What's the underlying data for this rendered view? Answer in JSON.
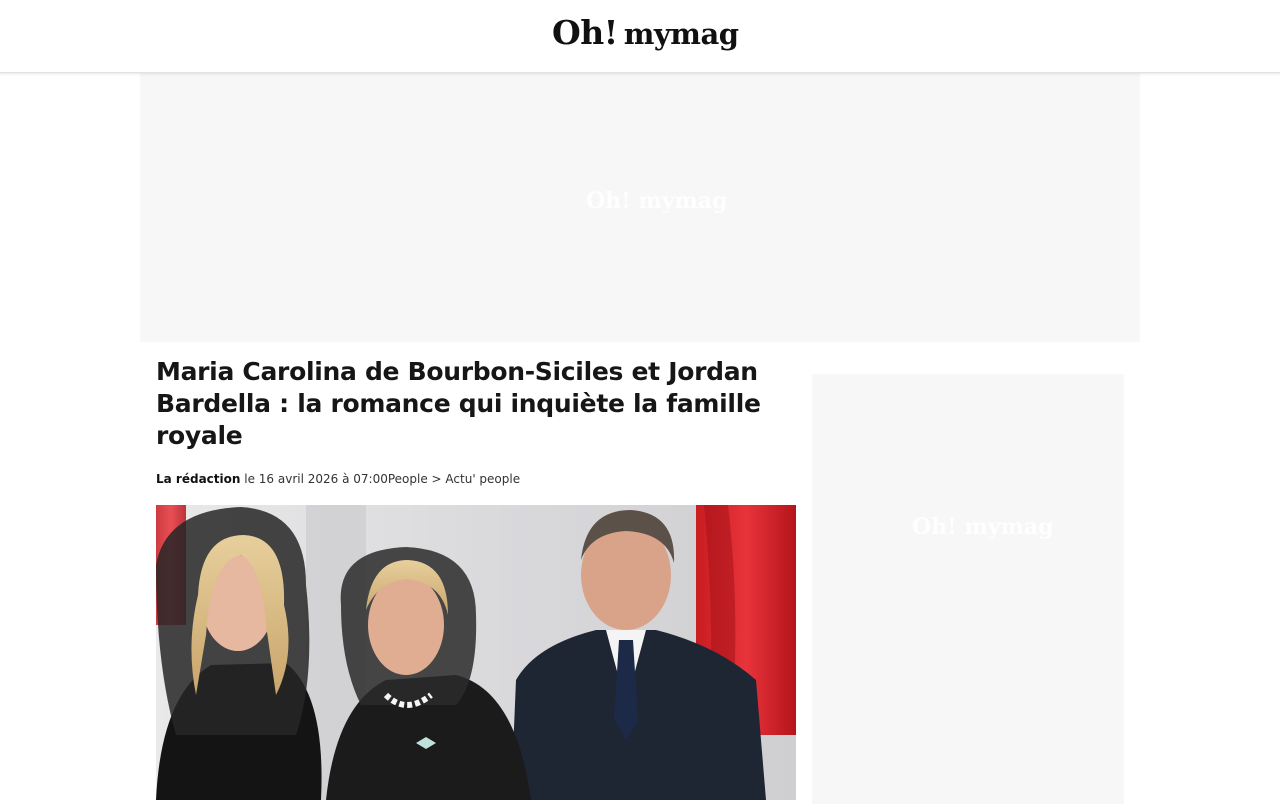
{
  "header": {
    "logo_oh": "Oh!",
    "logo_mymag": "mymag"
  },
  "ads": {
    "top_logo": "Oh! mymag",
    "side_logo": "Oh! mymag"
  },
  "article": {
    "title": "Maria Carolina de Bourbon-Siciles et Jordan Bardella : la romance qui inquiète la famille royale",
    "author": "La rédaction",
    "date": "le 16 avril 2026 à 07:00",
    "category": "People",
    "separator": " > ",
    "subcategory": "Actu' people"
  },
  "colors": {
    "accent": "#d8262f",
    "background": "#ffffff",
    "ad_background": "#f7f7f7"
  }
}
